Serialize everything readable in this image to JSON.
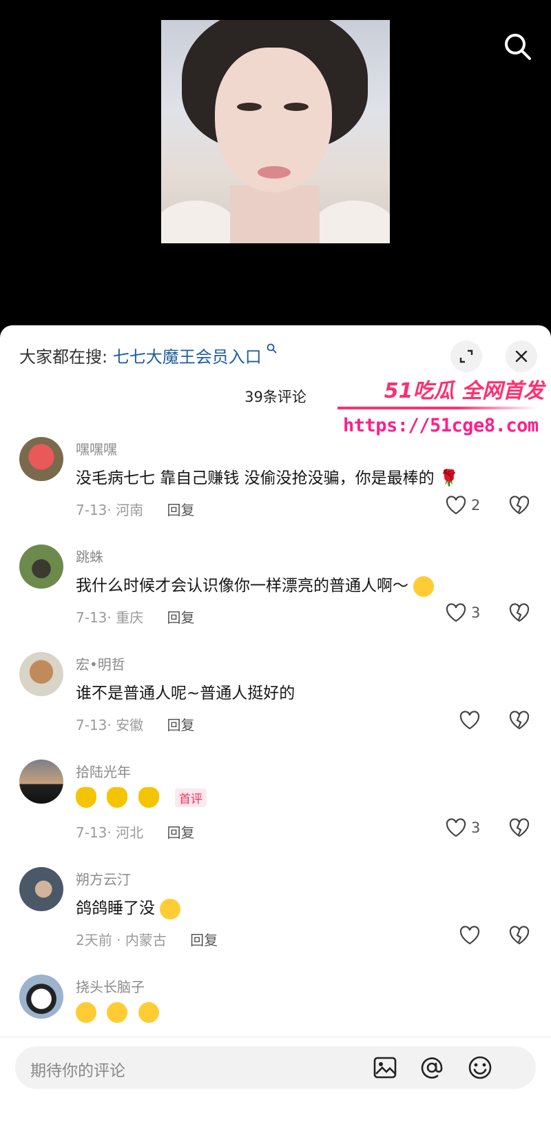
{
  "top": {
    "search_icon": "search-icon"
  },
  "sheet": {
    "hot_search_prefix": "大家都在搜:",
    "hot_search_link": "七七大魔王会员入口",
    "count": "39条评论"
  },
  "watermark": {
    "top": "51吃瓜 全网首发",
    "url": "https://51cge8.com"
  },
  "comments": [
    {
      "name": "嘿嘿嘿",
      "text": "没毛病七七 靠自己赚钱 没偷没抢没骗，你是最棒的 🌹",
      "date": "7-13",
      "loc": "河南",
      "reply": "回复",
      "likes": "2"
    },
    {
      "name": "跳蛛",
      "text": "我什么时候才会认识像你一样漂亮的普通人啊～",
      "date": "7-13",
      "loc": "重庆",
      "reply": "回复",
      "likes": "3"
    },
    {
      "name": "宏•明哲",
      "text": "谁不是普通人呢~普通人挺好的",
      "date": "7-13",
      "loc": "安徽",
      "reply": "回复",
      "likes": ""
    },
    {
      "name": "拾陆光年",
      "badge": "首评",
      "date": "7-13",
      "loc": "河北",
      "reply": "回复",
      "likes": "3"
    },
    {
      "name": "朔方云汀",
      "text": "鸽鸽睡了没",
      "date": "2天前",
      "loc": "内蒙古",
      "reply": "回复",
      "likes": ""
    },
    {
      "name": "挠头长脑子"
    }
  ],
  "input": {
    "placeholder": "期待你的评论"
  },
  "colors": {
    "link": "#1f5c9c",
    "watermark": "#ff2f6e",
    "badge": "#e8345d"
  }
}
